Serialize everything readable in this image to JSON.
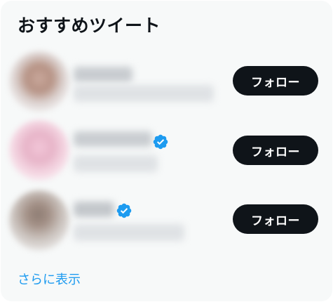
{
  "card": {
    "title": "おすすめツイート",
    "show_more_label": "さらに表示"
  },
  "accounts": [
    {
      "follow_label": "フォロー",
      "verified": false
    },
    {
      "follow_label": "フォロー",
      "verified": true
    },
    {
      "follow_label": "フォロー",
      "verified": true
    }
  ],
  "colors": {
    "follow_button_bg": "#0f1419",
    "follow_button_text": "#ffffff",
    "verified_badge": "#1d9bf0",
    "link": "#1d9bf0",
    "card_bg": "#f7f9f9"
  },
  "icons": {
    "verified": "verified-badge-icon"
  }
}
